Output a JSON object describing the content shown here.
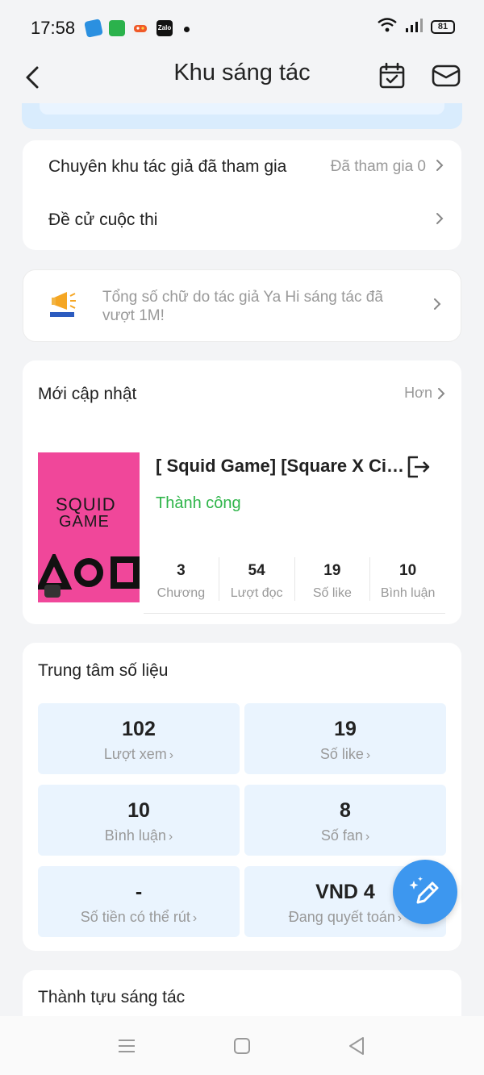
{
  "status_bar": {
    "time": "17:58",
    "notifications": [
      "telegram-icon",
      "app-green-icon",
      "game-icon",
      "zalo-icon"
    ],
    "zalo_label": "Zalo",
    "battery": "81"
  },
  "header": {
    "title": "Khu sáng tác",
    "icons": [
      "back-arrow-icon",
      "calendar-icon",
      "mail-icon"
    ]
  },
  "menu": {
    "items": [
      {
        "label": "Chuyên khu tác giả đã tham gia",
        "value": "Đã tham gia 0"
      },
      {
        "label": "Đề cử cuộc thi",
        "value": ""
      }
    ]
  },
  "promo": {
    "text": "Tổng số chữ do tác giả Ya Hi sáng tác đã vượt 1M!"
  },
  "recent": {
    "title": "Mới cập nhật",
    "more": "Hơn",
    "book": {
      "cover_line1": "SQUID",
      "cover_line2": "GAME",
      "title": "[ Squid Game] [Square X Circle]",
      "status": "Thành công",
      "stats": [
        {
          "value": "3",
          "label": "Chương"
        },
        {
          "value": "54",
          "label": "Lượt đọc"
        },
        {
          "value": "19",
          "label": "Số like"
        },
        {
          "value": "10",
          "label": "Bình luận"
        }
      ]
    }
  },
  "data_center": {
    "title": "Trung tâm số liệu",
    "tiles": [
      {
        "value": "102",
        "label": "Lượt xem"
      },
      {
        "value": "19",
        "label": "Số like"
      },
      {
        "value": "10",
        "label": "Bình luận"
      },
      {
        "value": "8",
        "label": "Số fan"
      },
      {
        "value": "-",
        "label": "Số tiền có thể rút"
      },
      {
        "value": "VND 4",
        "label": "Đang quyết toán"
      }
    ]
  },
  "achievements": {
    "title": "Thành tựu sáng tác"
  },
  "colors": {
    "accent_blue": "#3d97ef",
    "success_green": "#2fb54a",
    "cover_pink": "#f0479a",
    "tile_bg": "#eaf4fe"
  }
}
